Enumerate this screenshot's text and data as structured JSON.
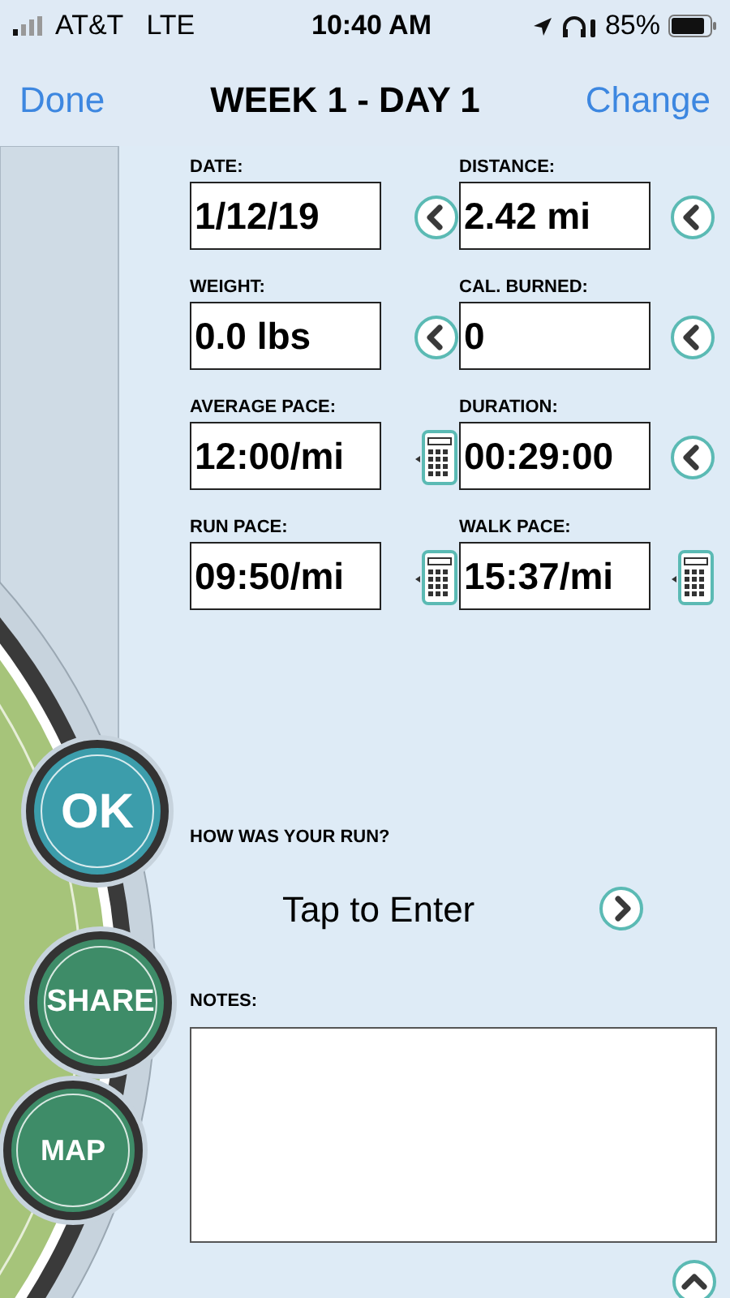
{
  "status_bar": {
    "carrier": "AT&T",
    "network": "LTE",
    "time": "10:40 AM",
    "battery": "85%"
  },
  "nav": {
    "left": "Done",
    "title": "WEEK 1 - DAY 1",
    "right": "Change"
  },
  "fields": [
    {
      "label": "DATE:",
      "value": "1/12/19",
      "kind": "picker"
    },
    {
      "label": "DISTANCE:",
      "value": "2.42 mi",
      "kind": "picker"
    },
    {
      "label": "WEIGHT:",
      "value": "0.0 lbs",
      "kind": "picker"
    },
    {
      "label": "CAL. BURNED:",
      "value": "0",
      "kind": "picker"
    },
    {
      "label": "AVERAGE PACE:",
      "value": "12:00/mi",
      "kind": "calculator"
    },
    {
      "label": "DURATION:",
      "value": "00:29:00",
      "kind": "picker"
    },
    {
      "label": "RUN PACE:",
      "value": "09:50/mi",
      "kind": "calculator"
    },
    {
      "label": "WALK PACE:",
      "value": "15:37/mi",
      "kind": "calculator"
    }
  ],
  "rating": {
    "label": "HOW WAS YOUR RUN?",
    "value": "Tap to Enter"
  },
  "notes": {
    "label": "NOTES:"
  },
  "side_buttons": [
    {
      "label": "OK",
      "color": "#3c9dab"
    },
    {
      "label": "SHARE",
      "color": "#3e8c68"
    },
    {
      "label": "MAP",
      "color": "#3e8c68"
    }
  ]
}
